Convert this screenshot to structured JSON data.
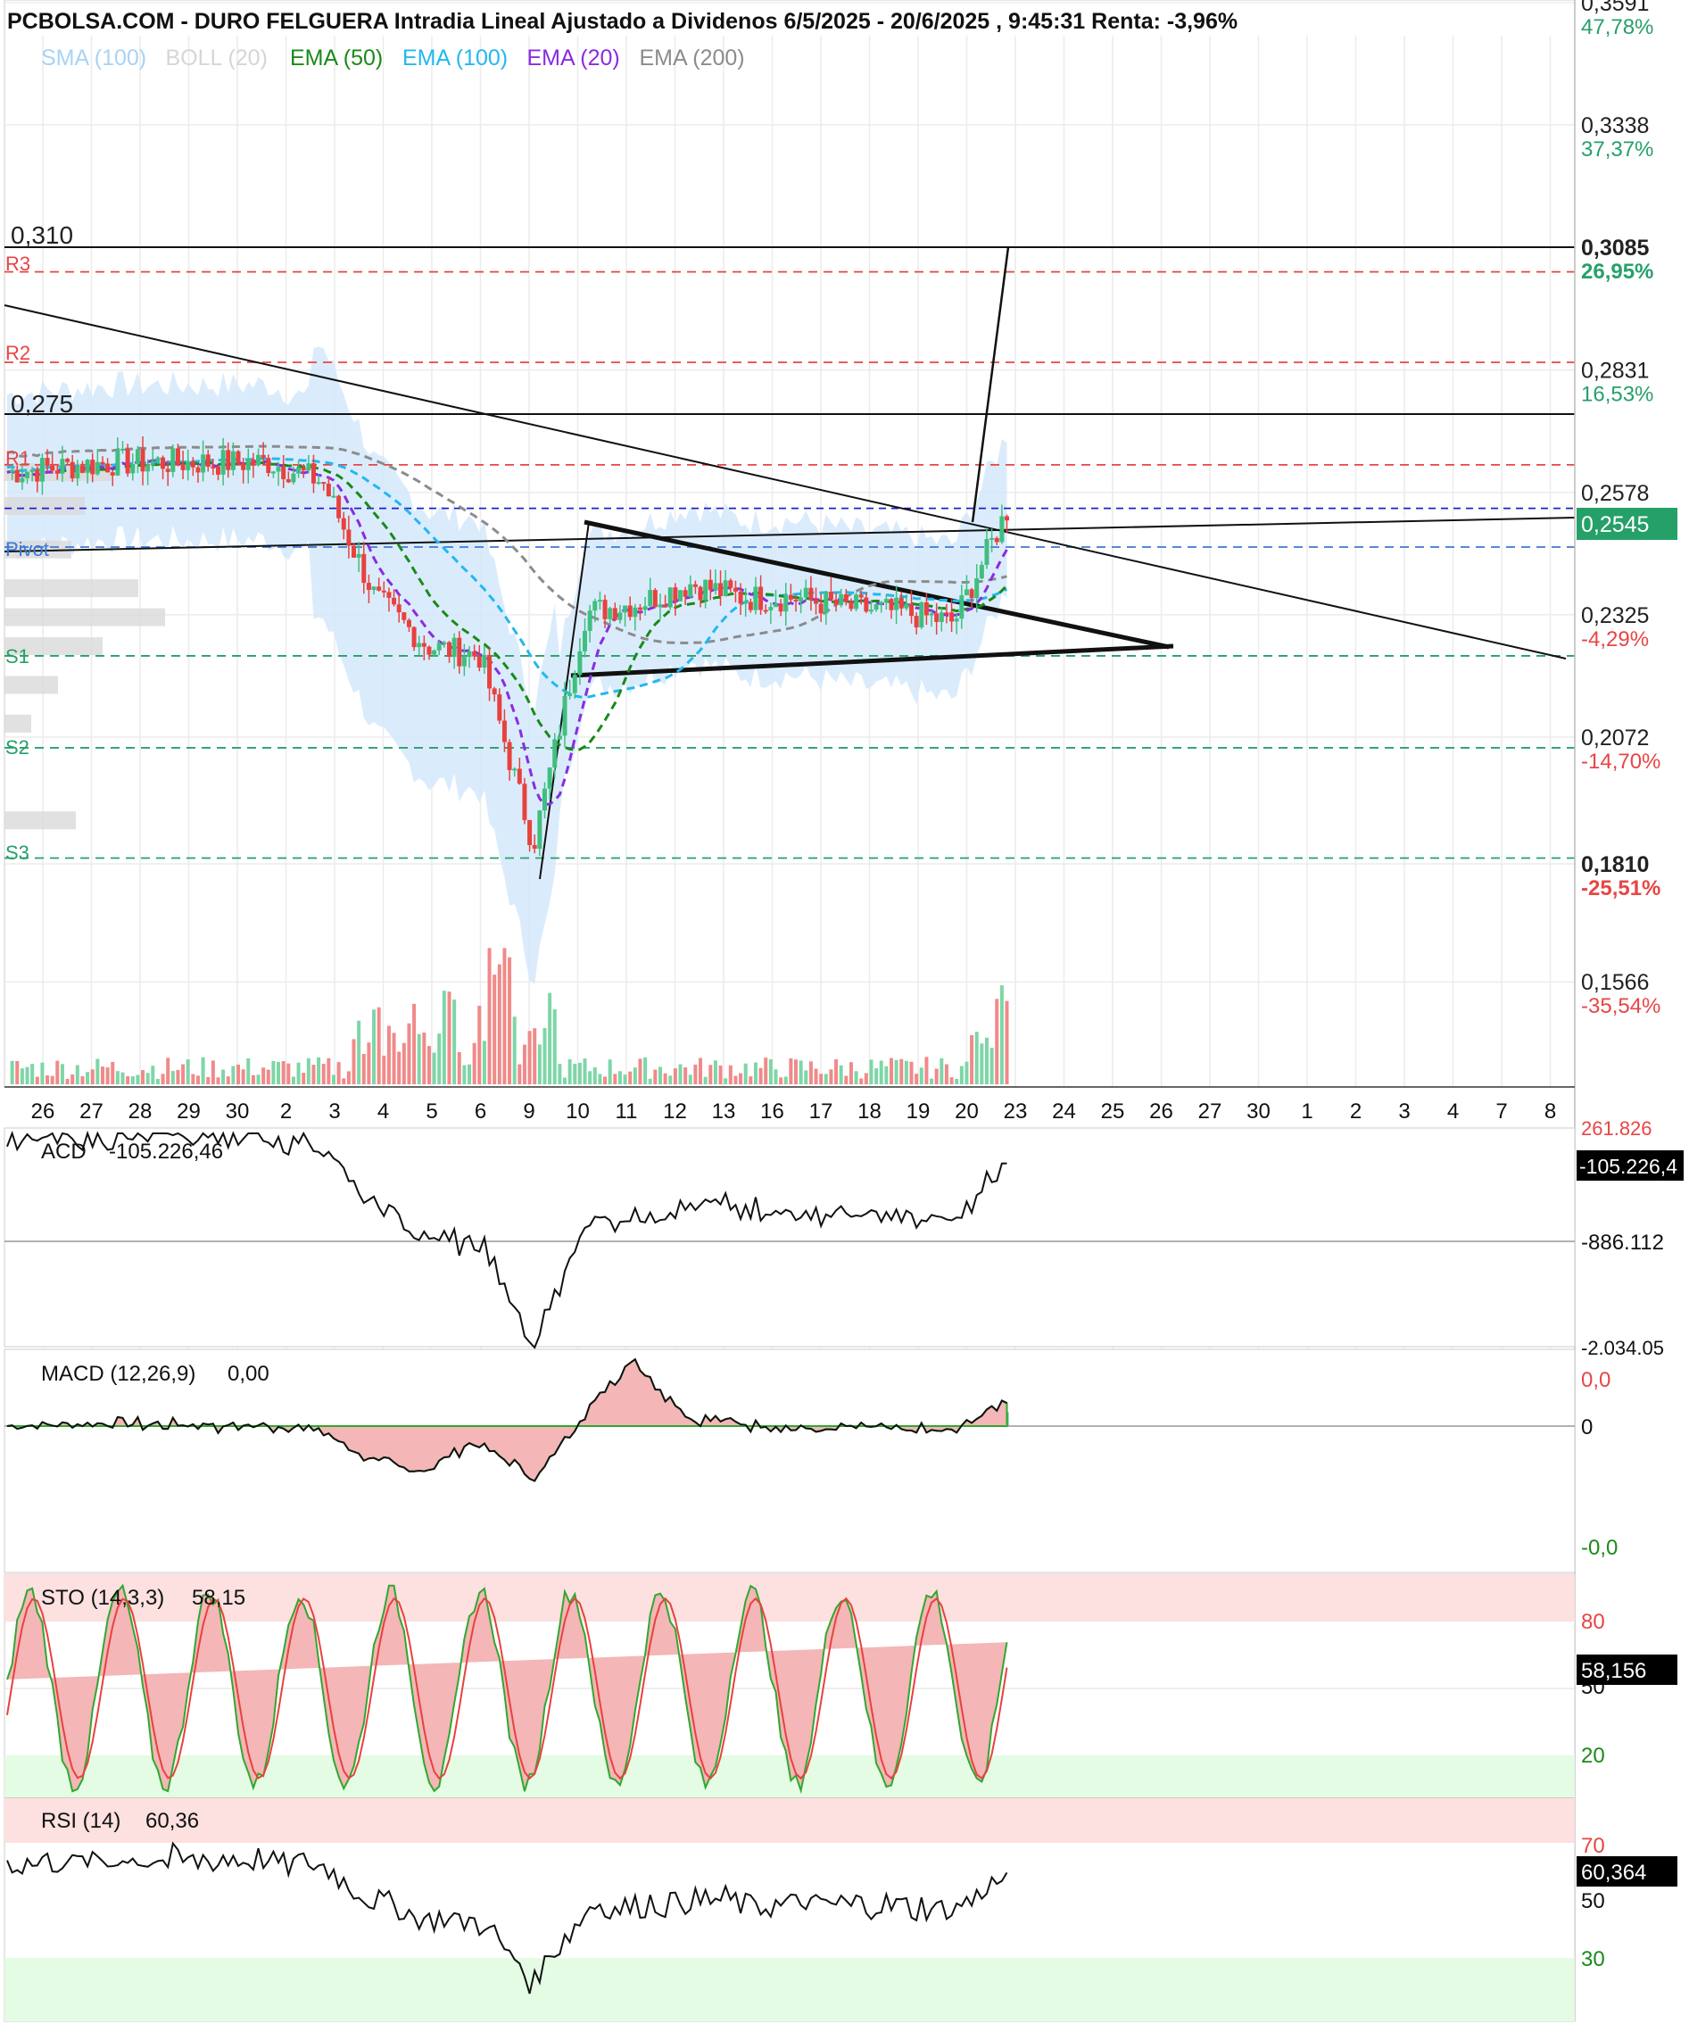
{
  "title": "PCBOLSA.COM - DURO FELGUERA Intradia Lineal Ajustado a Dividenos 6/5/2025 - 20/6/2025 , 9:45:31 Renta: -3,96%",
  "legend": [
    {
      "label": "SMA (100)",
      "color": "#a9d3f5"
    },
    {
      "label": "BOLL (20)",
      "color": "#d6d6d6"
    },
    {
      "label": "EMA (50)",
      "color": "#1a8a1a"
    },
    {
      "label": "EMA (100)",
      "color": "#22b8ee"
    },
    {
      "label": "EMA (20)",
      "color": "#8a2be2"
    },
    {
      "label": "EMA (200)",
      "color": "#8c8c8c"
    }
  ],
  "colors": {
    "up": "#3fbf7f",
    "down": "#e8413f",
    "resistance": "#e84545",
    "support": "#26a069",
    "pivot": "#3a7ad6",
    "price_badge": "#26a069"
  },
  "price_axis": [
    {
      "price": "0,3591",
      "pct": "47,78%",
      "value": 0.3591,
      "pct_color": "#26a069"
    },
    {
      "price": "0,3338",
      "pct": "37,37%",
      "value": 0.3338,
      "pct_color": "#26a069"
    },
    {
      "price": "0,3085",
      "pct": "26,95%",
      "value": 0.3085,
      "pct_color": "#26a069",
      "bold": true
    },
    {
      "price": "0,2831",
      "pct": "16,53%",
      "value": 0.2831,
      "pct_color": "#26a069"
    },
    {
      "price": "0,2578",
      "pct": "",
      "value": 0.2578,
      "pct_color": "#26a069"
    },
    {
      "price": "0,2325",
      "pct": "-4,29%",
      "value": 0.2325,
      "pct_color": "#e84545"
    },
    {
      "price": "0,2072",
      "pct": "-14,70%",
      "value": 0.2072,
      "pct_color": "#e84545"
    },
    {
      "price": "0,1810",
      "pct": "-25,51%",
      "value": 0.181,
      "pct_color": "#e84545",
      "bold": true
    },
    {
      "price": "0,1566",
      "pct": "-35,54%",
      "value": 0.1566,
      "pct_color": "#e84545"
    }
  ],
  "current_price": "0,2545",
  "levels": {
    "h310": {
      "label": "0,310",
      "value": 0.3085
    },
    "h275": {
      "label": "0,275",
      "value": 0.274
    },
    "R3": {
      "label": "R3",
      "value": 0.3034
    },
    "R2": {
      "label": "R2",
      "value": 0.2847
    },
    "R1": {
      "label": "R1",
      "value": 0.2635
    },
    "pivot_top": {
      "value": 0.2545
    },
    "Pivot": {
      "label": "Pivot",
      "value": 0.2465
    },
    "S1": {
      "label": "S1",
      "value": 0.224
    },
    "S2": {
      "label": "S2",
      "value": 0.205
    },
    "S3": {
      "label": "S3",
      "value": 0.1822
    }
  },
  "x_axis_labels": [
    "26",
    "27",
    "28",
    "29",
    "30",
    "2",
    "3",
    "4",
    "5",
    "6",
    "9",
    "10",
    "11",
    "12",
    "13",
    "16",
    "17",
    "18",
    "19",
    "20",
    "23",
    "24",
    "25",
    "26",
    "27",
    "30",
    "1",
    "2",
    "3",
    "4",
    "7",
    "8"
  ],
  "panels": {
    "acd": {
      "label": "ACD",
      "value": "-105.226,46",
      "axis_top": "261.826",
      "axis_mid": "-886.112",
      "axis_bot": "-2.034.05",
      "badge": "-105.226,4"
    },
    "macd": {
      "label": "MACD (12,26,9)",
      "value": "0,00",
      "axis_top": "0,0",
      "axis_mid": "0",
      "axis_bot": "-0,0"
    },
    "sto": {
      "label": "STO (14,3,3)",
      "value": "58,15",
      "axis_80": "80",
      "axis_50": "50",
      "axis_20": "20",
      "badge": "58,156"
    },
    "rsi": {
      "label": "RSI (14)",
      "value": "60,36",
      "axis_70": "70",
      "axis_50": "50",
      "axis_30": "30",
      "badge": "60,364"
    }
  },
  "chart_data": {
    "type": "line",
    "title": "PCBOLSA.COM - DURO FELGUERA Intradia Lineal Ajustado a Dividenos 6/5/2025 - 20/6/2025 , 9:45:31 Renta: -3,96%",
    "x": [
      "26",
      "27",
      "28",
      "29",
      "30",
      "2",
      "3",
      "4",
      "5",
      "6",
      "9",
      "10",
      "11",
      "12",
      "13",
      "16",
      "17",
      "18",
      "19",
      "20"
    ],
    "series": [
      {
        "name": "",
        "values": [
          0.262,
          0.263,
          0.264,
          0.264,
          0.264,
          0.264,
          0.26,
          0.236,
          0.226,
          0.224,
          0.185,
          0.233,
          0.235,
          0.239,
          0.236,
          0.236,
          0.234,
          0.233,
          0.231,
          0.254
        ]
      }
    ],
    "ylim": [
      0.14,
      0.365
    ],
    "grid": true
  }
}
